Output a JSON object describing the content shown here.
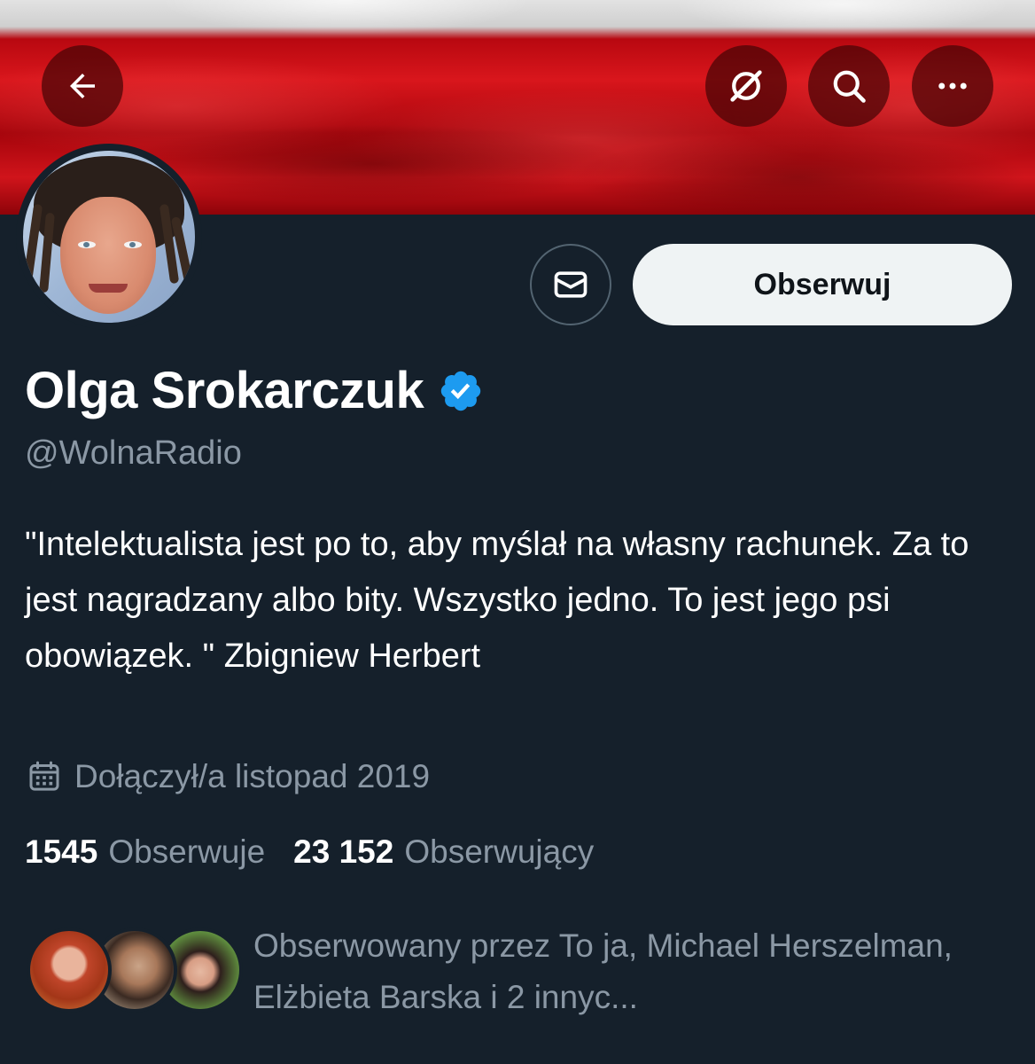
{
  "header": {
    "back_icon": "arrow-left-icon",
    "grok_icon": "grok-icon",
    "search_icon": "search-icon",
    "more_icon": "more-horizontal-icon"
  },
  "profile": {
    "name": "Olga Srokarczuk",
    "handle": "@WolnaRadio",
    "verified": true,
    "bio": "\"Intelektualista jest po to, aby myślał na własny rachunek. Za to jest nagradzany albo bity. Wszystko jedno. To jest jego psi obowiązek. \" Zbigniew Herbert",
    "joined": "Dołączył/a listopad 2019"
  },
  "actions": {
    "message_icon": "mail-icon",
    "follow_label": "Obserwuj"
  },
  "stats": {
    "following_count": "1545",
    "following_label": "Obserwuje",
    "followers_count": "23 152",
    "followers_label": "Obserwujący"
  },
  "followed_by": {
    "text": "Obserwowany przez To ja, Michael Herszelman, Elżbieta Barska i 2 innyc..."
  },
  "colors": {
    "background": "#15202b",
    "secondary_text": "#8b98a5",
    "verified_blue": "#1d9bf0",
    "follow_button_bg": "#eff3f4"
  }
}
